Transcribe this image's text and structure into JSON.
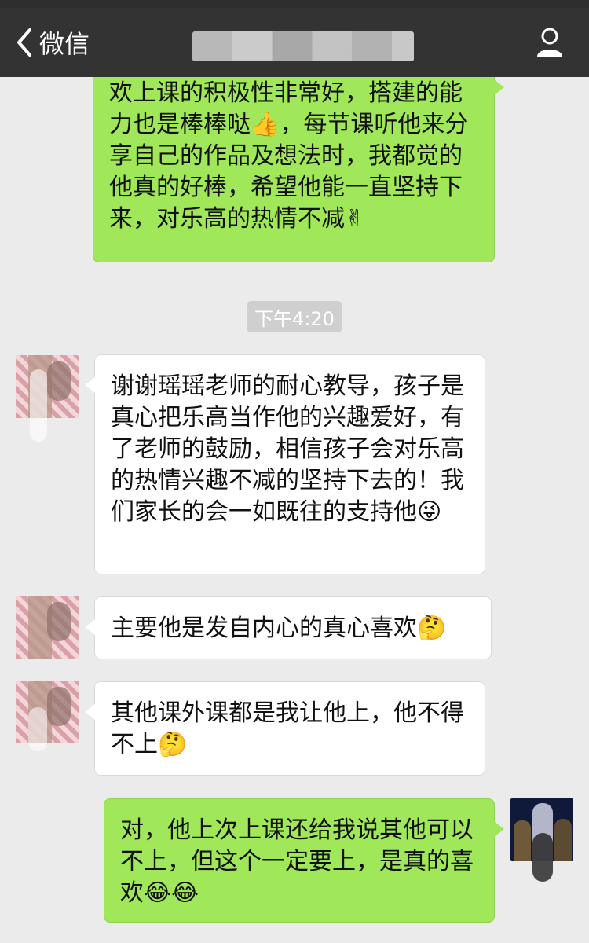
{
  "header": {
    "back_label": "微信"
  },
  "messages": [
    {
      "side": "right",
      "text": "欢上课的积极性非常好，搭建的能力也是棒棒哒👍，每节课听他来分享自己的作品及想法时，我都觉的他真的好棒，希望他能一直坚持下来，对乐高的热情不减✌"
    },
    {
      "side": "left",
      "text": "谢谢瑶瑶老师的耐心教导，孩子是真心把乐高当作他的兴趣爱好，有了老师的鼓励，相信孩子会对乐高的热情兴趣不减的坚持下去的！我们家长的会一如既往的支持他😜"
    },
    {
      "side": "left",
      "text": "主要他是发自内心的真心喜欢🤔"
    },
    {
      "side": "left",
      "text": "其他课外课都是我让他上，他不得不上🤔"
    },
    {
      "side": "right",
      "text": "对，他上次上课还给我说其他可以不上，但这个一定要上，是真的喜欢😂😂"
    }
  ],
  "timestamp": "下午4:20",
  "icons": {
    "back": "chevron-left-icon",
    "profile": "person-icon"
  },
  "colors": {
    "navbar": "#333333",
    "background": "#ebebeb",
    "bubble_green": "#a0e75a",
    "bubble_white": "#ffffff"
  }
}
